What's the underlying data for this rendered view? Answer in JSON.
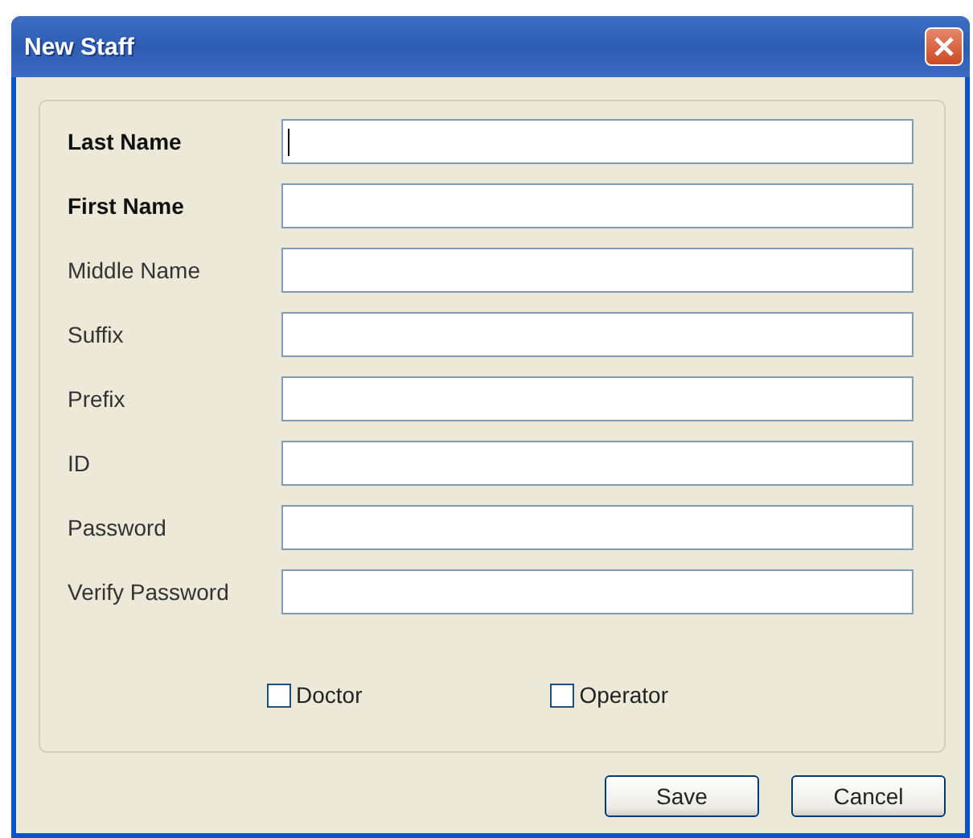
{
  "window": {
    "title": "New Staff"
  },
  "fields": [
    {
      "label": "Last Name",
      "required": true,
      "focused": true
    },
    {
      "label": "First Name",
      "required": true,
      "focused": false
    },
    {
      "label": "Middle Name",
      "required": false,
      "focused": false
    },
    {
      "label": "Suffix",
      "required": false,
      "focused": false
    },
    {
      "label": "Prefix",
      "required": false,
      "focused": false
    },
    {
      "label": "ID",
      "required": false,
      "focused": false
    },
    {
      "label": "Password",
      "required": false,
      "focused": false
    },
    {
      "label": "Verify Password",
      "required": false,
      "focused": false
    }
  ],
  "checkboxes": [
    {
      "label": "Doctor",
      "checked": false
    },
    {
      "label": "Operator",
      "checked": false
    }
  ],
  "buttons": [
    "Save",
    "Cancel"
  ]
}
